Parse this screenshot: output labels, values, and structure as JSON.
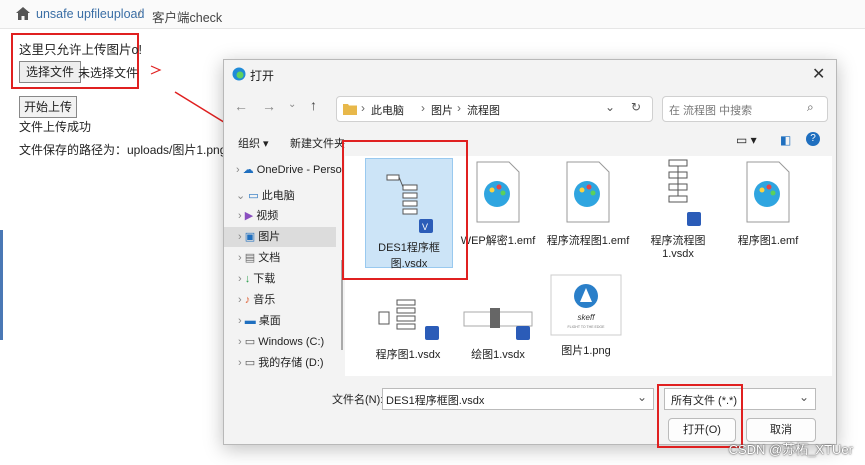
{
  "breadcrumb": {
    "link": "unsafe upfileupload",
    "sep": "/",
    "current": "客户端check"
  },
  "upload": {
    "hint": "这里只允许上传图片o!",
    "choose_label": "选择文件",
    "no_file": "未选择文件",
    "start_label": "开始上传",
    "success": "文件上传成功",
    "path": "文件保存的路径为：uploads/图片1.png"
  },
  "dialog": {
    "title": "打开",
    "address": [
      "此电脑",
      "图片",
      "流程图"
    ],
    "search_placeholder": "在 流程图 中搜索",
    "organize": "组织 ▾",
    "new_folder": "新建文件夹",
    "sidebar": [
      {
        "label": "OneDrive - Perso",
        "icon": "cloud-icon"
      },
      {
        "label": "此电脑",
        "icon": "pc-icon"
      },
      {
        "label": "视频",
        "icon": "video-icon"
      },
      {
        "label": "图片",
        "icon": "picture-icon"
      },
      {
        "label": "文档",
        "icon": "document-icon"
      },
      {
        "label": "下载",
        "icon": "download-icon"
      },
      {
        "label": "音乐",
        "icon": "music-icon"
      },
      {
        "label": "桌面",
        "icon": "desktop-icon"
      },
      {
        "label": "Windows (C:)",
        "icon": "drive-icon"
      },
      {
        "label": "我的存储 (D:)",
        "icon": "drive-icon"
      }
    ],
    "files": [
      {
        "name": "DES1程序框图.vsdx",
        "kind": "vsdx",
        "selected": true
      },
      {
        "name": "WEP解密1.emf",
        "kind": "emf"
      },
      {
        "name": "程序流程图1.emf",
        "kind": "emf"
      },
      {
        "name": "程序流程图1.vsdx",
        "kind": "vsdx"
      },
      {
        "name": "程序图1.emf",
        "kind": "emf"
      },
      {
        "name": "程序图1.vsdx",
        "kind": "vsdx"
      },
      {
        "name": "绘图1.vsdx",
        "kind": "vsdx"
      },
      {
        "name": "图片1.png",
        "kind": "png",
        "logo_text": "skeff",
        "logo_sub": "FLIGHT TO THE EDGE"
      }
    ],
    "filename_label": "文件名(N):",
    "filename_value": "DES1程序框图.vsdx",
    "filetype": "所有文件 (*.*)",
    "open_label": "打开(O)",
    "cancel_label": "取消"
  },
  "watermark": "CSDN @苏柘_XTUer",
  "colors": {
    "accent": "#e02020",
    "link": "#3a6ea5",
    "select": "#cce4f7"
  }
}
